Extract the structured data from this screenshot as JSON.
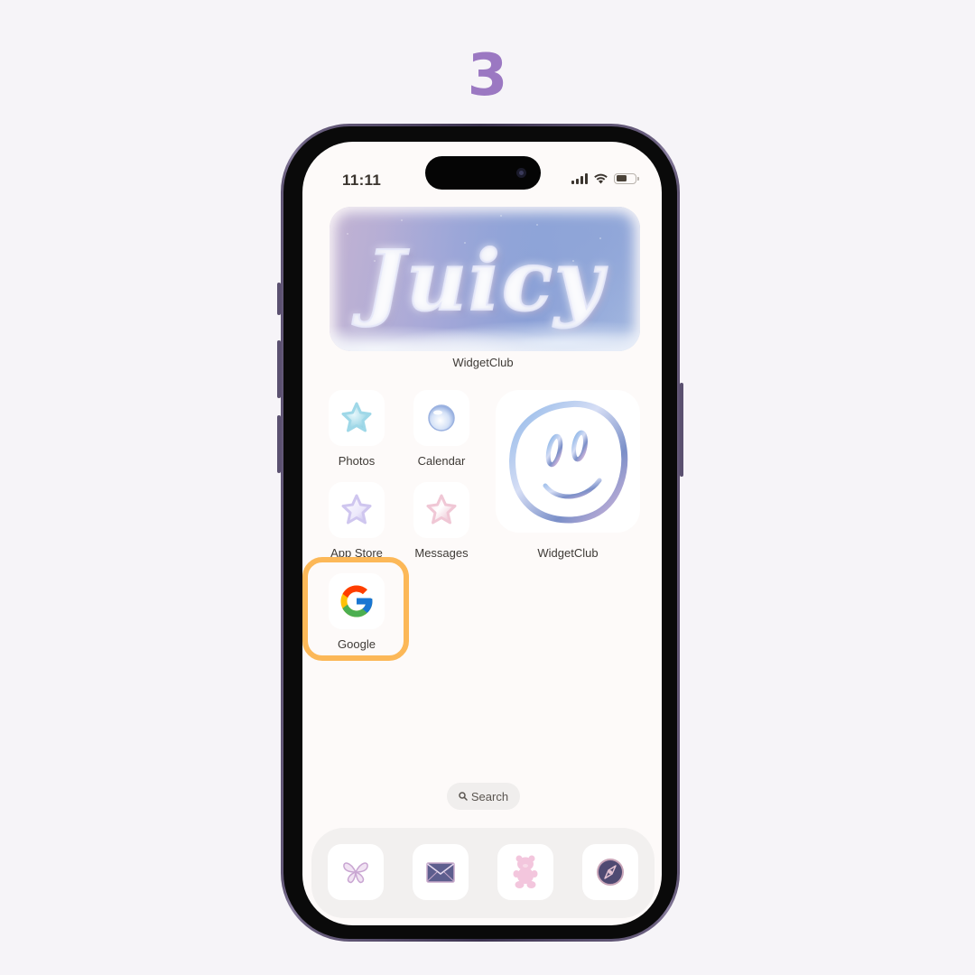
{
  "step": "3",
  "status_bar": {
    "time": "11:11",
    "signal_icon": "cellular-signal-icon",
    "wifi_icon": "wifi-icon",
    "battery_icon": "battery-icon",
    "battery_level": 0.55
  },
  "widgets": {
    "juicy": {
      "text": "Juicy",
      "label": "WidgetClub"
    },
    "smiley": {
      "icon": "smiley-face-icon",
      "label": "WidgetClub"
    }
  },
  "apps": [
    {
      "label": "Photos",
      "icon": "blue-star-icon",
      "color": "#9fd8e8"
    },
    {
      "label": "Calendar",
      "icon": "bubble-orb-icon",
      "color": "#b8cdf0"
    },
    {
      "label": "App Store",
      "icon": "lilac-star-icon",
      "color": "#cfc6ef"
    },
    {
      "label": "Messages",
      "icon": "pink-star-icon",
      "color": "#f0c7d5"
    },
    {
      "label": "Google",
      "icon": "google-g-icon"
    }
  ],
  "highlight": {
    "target": "Google",
    "color": "#fcb858"
  },
  "search": {
    "label": "Search",
    "icon": "search-icon"
  },
  "dock": [
    {
      "icon": "butterfly-icon"
    },
    {
      "icon": "envelope-icon"
    },
    {
      "icon": "gummy-bear-icon"
    },
    {
      "icon": "compass-icon"
    }
  ]
}
